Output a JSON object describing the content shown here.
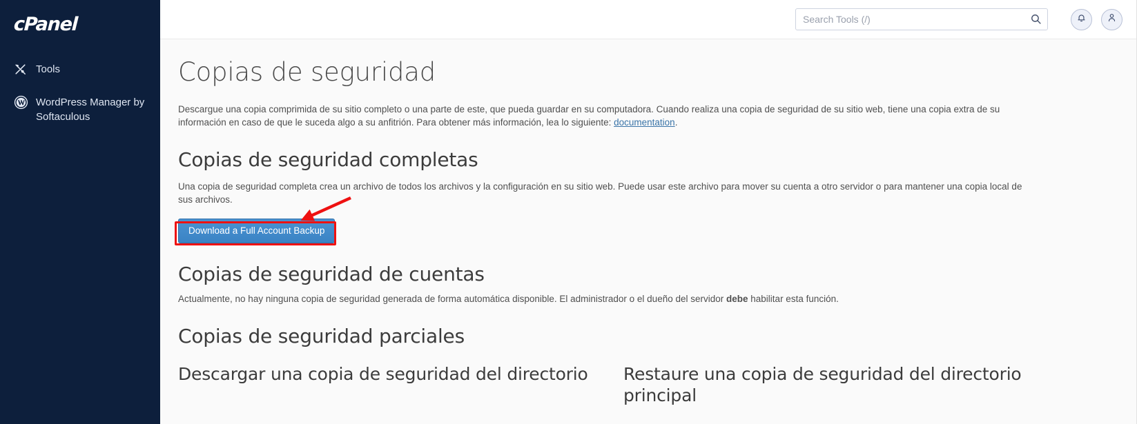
{
  "sidebar": {
    "brand": "cPanel",
    "items": [
      {
        "label": "Tools",
        "icon": "tools-icon"
      },
      {
        "label": "WordPress Manager by Softaculous",
        "icon": "wordpress-icon"
      }
    ]
  },
  "header": {
    "search": {
      "placeholder": "Search Tools (/)",
      "value": "",
      "icon": "search-icon"
    },
    "notifications_icon": "bell-icon",
    "account_icon": "user-icon"
  },
  "page": {
    "title": "Copias de seguridad",
    "intro": {
      "text_before_link": "Descargue una copia comprimida de su sitio completo o una parte de este, que pueda guardar en su computadora. Cuando realiza una copia de seguridad de su sitio web, tiene una copia extra de su información en caso de que le suceda algo a su anfitrión. Para obtener más información, lea lo siguiente: ",
      "link_label": "documentation",
      "text_after_link": "."
    },
    "full_backups": {
      "heading": "Copias de seguridad completas",
      "description": "Una copia de seguridad completa crea un archivo de todos los archivos y la configuración en su sitio web. Puede usar este archivo para mover su cuenta a otro servidor o para mantener una copia local de sus archivos.",
      "button_label": "Download a Full Account Backup"
    },
    "account_backups": {
      "heading": "Copias de seguridad de cuentas",
      "text_before_bold": "Actualmente, no hay ninguna copia de seguridad generada de forma automática disponible. El administrador o el dueño del servidor ",
      "bold_text": "debe",
      "text_after_bold": " habilitar esta función."
    },
    "partial_backups": {
      "heading": "Copias de seguridad parciales",
      "left_column_title": "Descargar una copia de seguridad del directorio",
      "right_column_title": "Restaure una copia de seguridad del directorio principal"
    }
  },
  "annotation": {
    "highlight_color": "#ee1111",
    "arrow_color": "#ee1111"
  }
}
